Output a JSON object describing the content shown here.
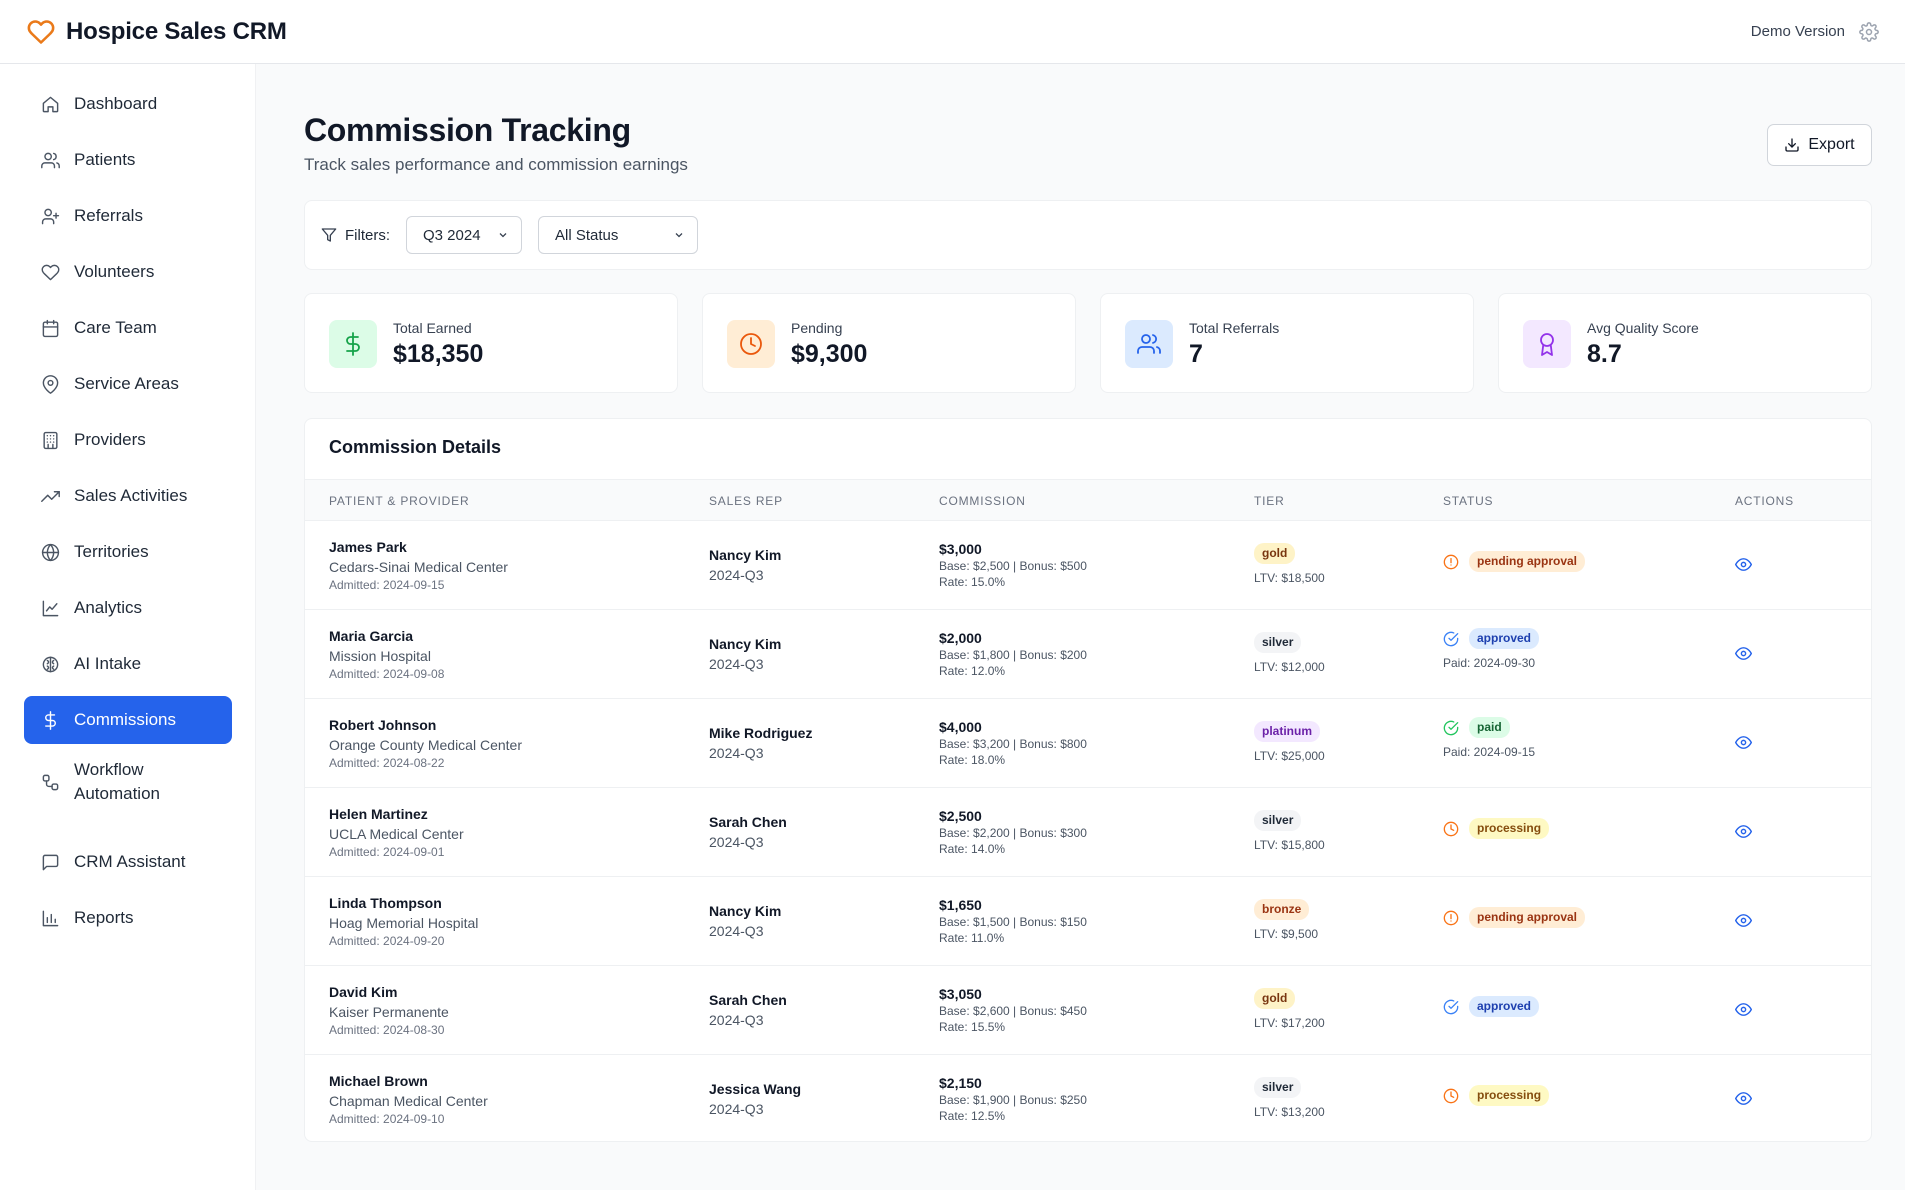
{
  "app": {
    "title": "Hospice Sales CRM",
    "version_label": "Demo Version"
  },
  "sidebar": {
    "items": [
      {
        "label": "Dashboard",
        "icon": "home-icon",
        "active": false
      },
      {
        "label": "Patients",
        "icon": "users-icon",
        "active": false
      },
      {
        "label": "Referrals",
        "icon": "user-plus-icon",
        "active": false
      },
      {
        "label": "Volunteers",
        "icon": "heart-icon",
        "active": false
      },
      {
        "label": "Care Team",
        "icon": "calendar-icon",
        "active": false
      },
      {
        "label": "Service Areas",
        "icon": "map-pin-icon",
        "active": false
      },
      {
        "label": "Providers",
        "icon": "building-icon",
        "active": false
      },
      {
        "label": "Sales Activities",
        "icon": "trending-up-icon",
        "active": false
      },
      {
        "label": "Territories",
        "icon": "globe-icon",
        "active": false
      },
      {
        "label": "Analytics",
        "icon": "line-chart-icon",
        "active": false
      },
      {
        "label": "AI Intake",
        "icon": "brain-icon",
        "active": false
      },
      {
        "label": "Commissions",
        "icon": "dollar-icon",
        "active": true
      },
      {
        "label": "Workflow Automation",
        "icon": "workflow-icon",
        "active": false
      },
      {
        "label": "CRM Assistant",
        "icon": "message-icon",
        "active": false
      },
      {
        "label": "Reports",
        "icon": "bar-chart-icon",
        "active": false
      }
    ]
  },
  "page": {
    "title": "Commission Tracking",
    "subtitle": "Track sales performance and commission earnings",
    "export_label": "Export"
  },
  "filters": {
    "label": "Filters:",
    "period": "Q3 2024",
    "status": "All Status"
  },
  "stats": [
    {
      "label": "Total Earned",
      "value": "$18,350",
      "icon": "dollar-icon",
      "color": "#16a34a",
      "bg": "#dcfce7"
    },
    {
      "label": "Pending",
      "value": "$9,300",
      "icon": "clock-icon",
      "color": "#ea580c",
      "bg": "#ffedd5"
    },
    {
      "label": "Total Referrals",
      "value": "7",
      "icon": "users-icon",
      "color": "#2563eb",
      "bg": "#dbeafe"
    },
    {
      "label": "Avg Quality Score",
      "value": "8.7",
      "icon": "award-icon",
      "color": "#9333ea",
      "bg": "#f3e8ff"
    }
  ],
  "table": {
    "title": "Commission Details",
    "columns": [
      "PATIENT & PROVIDER",
      "SALES REP",
      "COMMISSION",
      "TIER",
      "STATUS",
      "ACTIONS"
    ],
    "rows": [
      {
        "patient": "James Park",
        "provider": "Cedars-Sinai Medical Center",
        "admitted": "Admitted: 2024-09-15",
        "rep": "Nancy Kim",
        "period": "2024-Q3",
        "amount": "$3,000",
        "breakdown": "Base: $2,500 | Bonus: $500",
        "rate": "Rate: 15.0%",
        "tier": "gold",
        "ltv": "LTV: $18,500",
        "status": "pending approval",
        "status_kind": "pending",
        "paid": ""
      },
      {
        "patient": "Maria Garcia",
        "provider": "Mission Hospital",
        "admitted": "Admitted: 2024-09-08",
        "rep": "Nancy Kim",
        "period": "2024-Q3",
        "amount": "$2,000",
        "breakdown": "Base: $1,800 | Bonus: $200",
        "rate": "Rate: 12.0%",
        "tier": "silver",
        "ltv": "LTV: $12,000",
        "status": "approved",
        "status_kind": "approved",
        "paid": "Paid: 2024-09-30"
      },
      {
        "patient": "Robert Johnson",
        "provider": "Orange County Medical Center",
        "admitted": "Admitted: 2024-08-22",
        "rep": "Mike Rodriguez",
        "period": "2024-Q3",
        "amount": "$4,000",
        "breakdown": "Base: $3,200 | Bonus: $800",
        "rate": "Rate: 18.0%",
        "tier": "platinum",
        "ltv": "LTV: $25,000",
        "status": "paid",
        "status_kind": "paid",
        "paid": "Paid: 2024-09-15"
      },
      {
        "patient": "Helen Martinez",
        "provider": "UCLA Medical Center",
        "admitted": "Admitted: 2024-09-01",
        "rep": "Sarah Chen",
        "period": "2024-Q3",
        "amount": "$2,500",
        "breakdown": "Base: $2,200 | Bonus: $300",
        "rate": "Rate: 14.0%",
        "tier": "silver",
        "ltv": "LTV: $15,800",
        "status": "processing",
        "status_kind": "processing",
        "paid": ""
      },
      {
        "patient": "Linda Thompson",
        "provider": "Hoag Memorial Hospital",
        "admitted": "Admitted: 2024-09-20",
        "rep": "Nancy Kim",
        "period": "2024-Q3",
        "amount": "$1,650",
        "breakdown": "Base: $1,500 | Bonus: $150",
        "rate": "Rate: 11.0%",
        "tier": "bronze",
        "ltv": "LTV: $9,500",
        "status": "pending approval",
        "status_kind": "pending",
        "paid": ""
      },
      {
        "patient": "David Kim",
        "provider": "Kaiser Permanente",
        "admitted": "Admitted: 2024-08-30",
        "rep": "Sarah Chen",
        "period": "2024-Q3",
        "amount": "$3,050",
        "breakdown": "Base: $2,600 | Bonus: $450",
        "rate": "Rate: 15.5%",
        "tier": "gold",
        "ltv": "LTV: $17,200",
        "status": "approved",
        "status_kind": "approved",
        "paid": ""
      },
      {
        "patient": "Michael Brown",
        "provider": "Chapman Medical Center",
        "admitted": "Admitted: 2024-09-10",
        "rep": "Jessica Wang",
        "period": "2024-Q3",
        "amount": "$2,150",
        "breakdown": "Base: $1,900 | Bonus: $250",
        "rate": "Rate: 12.5%",
        "tier": "silver",
        "ltv": "LTV: $13,200",
        "status": "processing",
        "status_kind": "processing",
        "paid": ""
      }
    ]
  }
}
